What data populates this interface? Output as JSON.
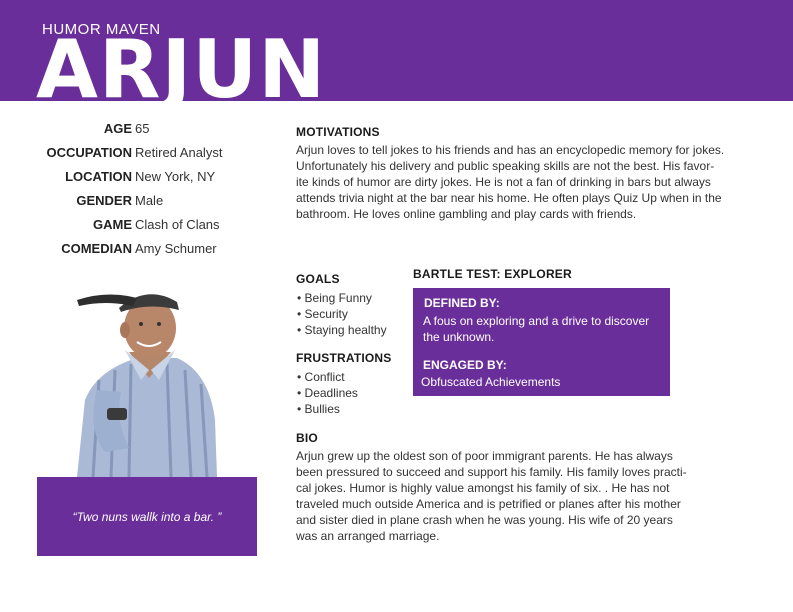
{
  "header": {
    "subtitle": "HUMOR MAVEN",
    "name": "ARJUN"
  },
  "facts": [
    {
      "label": "AGE",
      "value": "65"
    },
    {
      "label": "OCCUPATION",
      "value": "Retired Analyst"
    },
    {
      "label": "LOCATION",
      "value": "New York, NY"
    },
    {
      "label": "GENDER",
      "value": "Male"
    },
    {
      "label": "GAME",
      "value": "Clash of Clans"
    },
    {
      "label": "COMEDIAN",
      "value": "Amy Schumer"
    }
  ],
  "quote": "“Two nuns wallk into a bar. ”",
  "motivations": {
    "title": "MOTIVATIONS",
    "lines": [
      "Arjun loves to tell jokes to his friends and has an encyclopedic memory for jokes.",
      "Unfortunately his delivery and public speaking skills are not the best.  His favor-",
      "ite kinds of humor are dirty jokes. He is not a fan of drinking in bars but always",
      "attends trivia night at the bar near his home. He often plays Quiz Up when in the",
      "bathroom. He loves online gambling and play cards with friends."
    ]
  },
  "goals": {
    "title": "GOALS",
    "items": [
      "Being Funny",
      "Security",
      "Staying healthy"
    ]
  },
  "frustrations": {
    "title": "FRUSTRATIONS",
    "items": [
      "Conflict",
      "Deadlines",
      "Bullies"
    ]
  },
  "bartle": {
    "title": "BARTLE TEST: EXPLORER",
    "defined_label": "DEFINED BY:",
    "defined_lines": [
      "A fous on exploring and a drive to discover",
      "the unknown."
    ],
    "engaged_label": "ENGAGED BY:",
    "engaged_text": "Obfuscated Achievements"
  },
  "bio": {
    "title": "BIO",
    "lines": [
      "Arjun grew up the oldest son of poor immigrant parents. He has always",
      "been pressured to succeed and support his family. His family loves practi-",
      "cal jokes. Humor is highly value amongst his family of six. . He has not",
      "traveled much outside America and is petrified or planes after his mother",
      "and sister died in plane crash when he was young. His wife of 20 years",
      "was an arranged marriage."
    ]
  },
  "colors": {
    "brand_purple": "#6a2e9a"
  }
}
